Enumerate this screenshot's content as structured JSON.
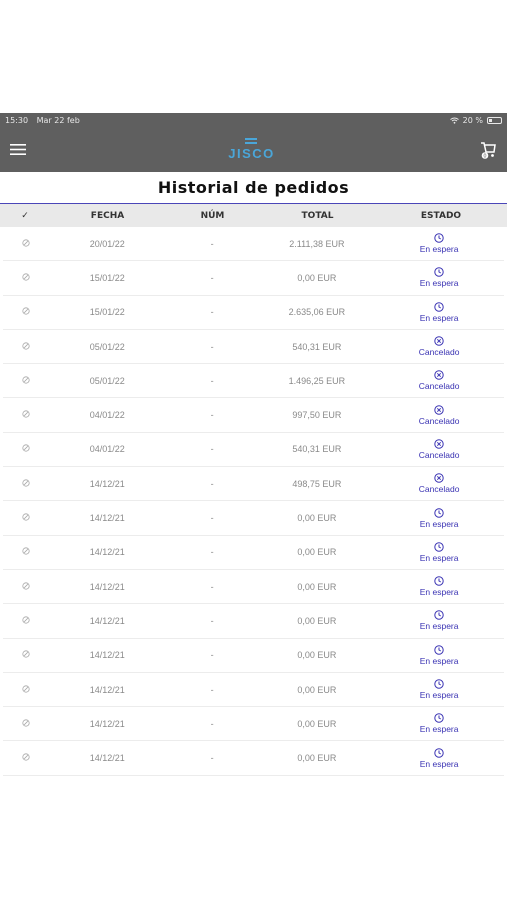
{
  "status_bar": {
    "time": "15:30",
    "date": "Mar 22 feb",
    "battery": "20 %",
    "battery_level": 0.2
  },
  "header": {
    "logo_text": "JISCO",
    "menu_icon": "hamburger-icon",
    "cart_icon": "cart-icon",
    "accent_color": "#4aa6d9",
    "bar_color": "#5f5f5f"
  },
  "page": {
    "title": "Historial de pedidos"
  },
  "table": {
    "columns": {
      "check": "✓",
      "fecha": "FECHA",
      "num": "NÚM",
      "total": "TOTAL",
      "estado": "ESTADO"
    },
    "status_color": "#3a33b3",
    "rows": [
      {
        "fecha": "20/01/22",
        "num": "-",
        "total": "2.111,38 EUR",
        "estado": "En espera",
        "icon": "clock-icon"
      },
      {
        "fecha": "15/01/22",
        "num": "-",
        "total": "0,00 EUR",
        "estado": "En espera",
        "icon": "clock-icon"
      },
      {
        "fecha": "15/01/22",
        "num": "-",
        "total": "2.635,06 EUR",
        "estado": "En espera",
        "icon": "clock-icon"
      },
      {
        "fecha": "05/01/22",
        "num": "-",
        "total": "540,31 EUR",
        "estado": "Cancelado",
        "icon": "cancel-icon"
      },
      {
        "fecha": "05/01/22",
        "num": "-",
        "total": "1.496,25 EUR",
        "estado": "Cancelado",
        "icon": "cancel-icon"
      },
      {
        "fecha": "04/01/22",
        "num": "-",
        "total": "997,50 EUR",
        "estado": "Cancelado",
        "icon": "cancel-icon"
      },
      {
        "fecha": "04/01/22",
        "num": "-",
        "total": "540,31 EUR",
        "estado": "Cancelado",
        "icon": "cancel-icon"
      },
      {
        "fecha": "14/12/21",
        "num": "-",
        "total": "498,75 EUR",
        "estado": "Cancelado",
        "icon": "cancel-icon"
      },
      {
        "fecha": "14/12/21",
        "num": "-",
        "total": "0,00 EUR",
        "estado": "En espera",
        "icon": "clock-icon"
      },
      {
        "fecha": "14/12/21",
        "num": "-",
        "total": "0,00 EUR",
        "estado": "En espera",
        "icon": "clock-icon"
      },
      {
        "fecha": "14/12/21",
        "num": "-",
        "total": "0,00 EUR",
        "estado": "En espera",
        "icon": "clock-icon"
      },
      {
        "fecha": "14/12/21",
        "num": "-",
        "total": "0,00 EUR",
        "estado": "En espera",
        "icon": "clock-icon"
      },
      {
        "fecha": "14/12/21",
        "num": "-",
        "total": "0,00 EUR",
        "estado": "En espera",
        "icon": "clock-icon"
      },
      {
        "fecha": "14/12/21",
        "num": "-",
        "total": "0,00 EUR",
        "estado": "En espera",
        "icon": "clock-icon"
      },
      {
        "fecha": "14/12/21",
        "num": "-",
        "total": "0,00 EUR",
        "estado": "En espera",
        "icon": "clock-icon"
      },
      {
        "fecha": "14/12/21",
        "num": "-",
        "total": "0,00 EUR",
        "estado": "En espera",
        "icon": "clock-icon"
      }
    ]
  }
}
